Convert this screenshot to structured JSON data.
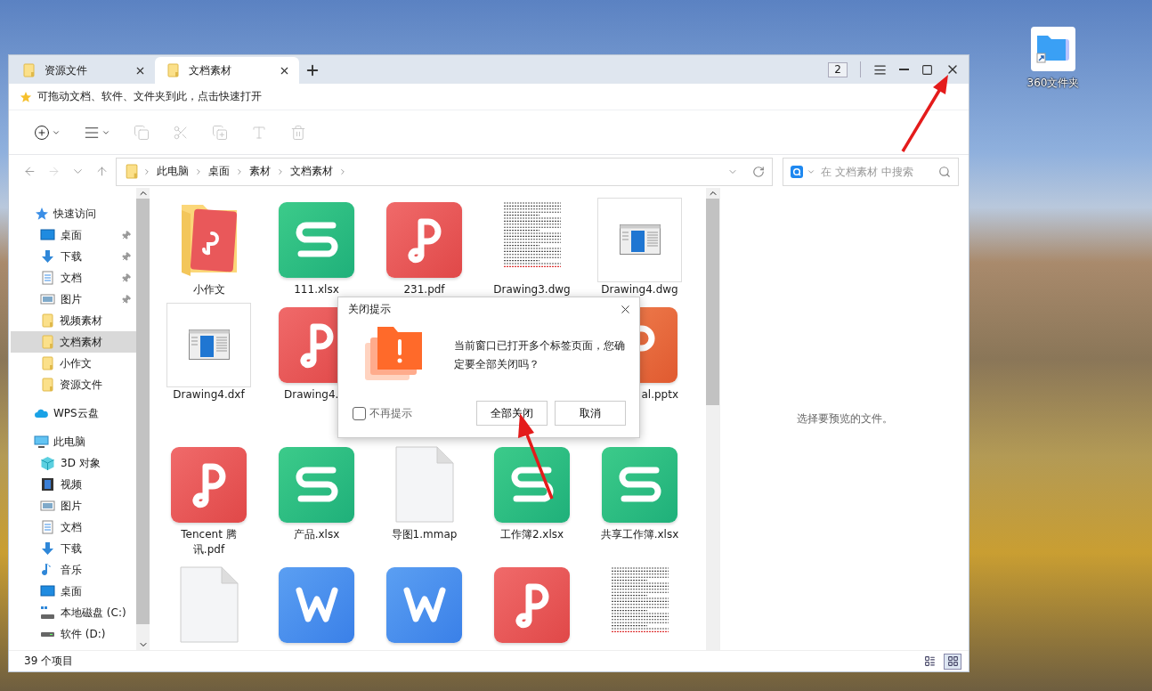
{
  "window": {
    "tabs": [
      {
        "label": "资源文件",
        "selected": false
      },
      {
        "label": "文档素材",
        "selected": true
      }
    ],
    "tab_count": "2",
    "quick_bar": {
      "hint": "可拖动文档、软件、文件夹到此，点击快速打开"
    },
    "toolbar": [
      {
        "kind": "new",
        "disabled": false,
        "dropdown": true
      },
      {
        "kind": "view",
        "disabled": false,
        "dropdown": true
      },
      {
        "kind": "copy",
        "disabled": true,
        "dropdown": false
      },
      {
        "kind": "cut",
        "disabled": true,
        "dropdown": false
      },
      {
        "kind": "paste",
        "disabled": true,
        "dropdown": false
      },
      {
        "kind": "rename",
        "disabled": true,
        "dropdown": false
      },
      {
        "kind": "delete",
        "disabled": true,
        "dropdown": false
      }
    ],
    "nav": [
      {
        "kind": "back",
        "disabled": false
      },
      {
        "kind": "forward",
        "disabled": true
      },
      {
        "kind": "recent",
        "disabled": false
      },
      {
        "kind": "up",
        "disabled": false
      }
    ],
    "address": {
      "breadcrumbs": [
        "此电脑",
        "桌面",
        "素材",
        "文档素材"
      ]
    },
    "search": {
      "placeholder": "在 文档素材 中搜索"
    },
    "sidebar": {
      "groups": [
        {
          "label": "快速访问",
          "kind": "star",
          "children": [
            {
              "label": "桌面",
              "kind": "desktop",
              "pinned": true,
              "selected": false
            },
            {
              "label": "下载",
              "kind": "download",
              "pinned": true,
              "selected": false
            },
            {
              "label": "文档",
              "kind": "document",
              "pinned": true,
              "selected": false
            },
            {
              "label": "图片",
              "kind": "picture",
              "pinned": true,
              "selected": false
            },
            {
              "label": "视频素材",
              "kind": "folder",
              "pinned": false,
              "selected": false
            },
            {
              "label": "文档素材",
              "kind": "folder",
              "pinned": false,
              "selected": true
            },
            {
              "label": "小作文",
              "kind": "folder",
              "pinned": false,
              "selected": false
            },
            {
              "label": "资源文件",
              "kind": "folder",
              "pinned": false,
              "selected": false
            }
          ]
        },
        {
          "label": "WPS云盘",
          "kind": "cloud"
        },
        {
          "label": "此电脑",
          "kind": "pc",
          "children": [
            {
              "label": "3D 对象",
              "kind": "cube",
              "pinned": false,
              "selected": false
            },
            {
              "label": "视频",
              "kind": "video",
              "pinned": false,
              "selected": false
            },
            {
              "label": "图片",
              "kind": "picture",
              "pinned": false,
              "selected": false
            },
            {
              "label": "文档",
              "kind": "document",
              "pinned": false,
              "selected": false
            },
            {
              "label": "下载",
              "kind": "download",
              "pinned": false,
              "selected": false
            },
            {
              "label": "音乐",
              "kind": "music",
              "pinned": false,
              "selected": false
            },
            {
              "label": "桌面",
              "kind": "desktop",
              "pinned": false,
              "selected": false
            },
            {
              "label": "本地磁盘 (C:)",
              "kind": "system-drive",
              "pinned": false,
              "selected": false
            },
            {
              "label": "软件 (D:)",
              "kind": "drive",
              "pinned": false,
              "selected": false
            }
          ]
        }
      ]
    },
    "files": {
      "rows": [
        [
          {
            "name": "小作文",
            "kind": "folder"
          },
          {
            "name": "111.xlsx",
            "kind": "sheet"
          },
          {
            "name": "231.pdf",
            "kind": "pdf"
          },
          {
            "name": "Drawing3.dwg",
            "kind": "text-page"
          },
          {
            "name": "Drawing4.dwg",
            "kind": "cad"
          }
        ],
        [
          {
            "name": "Drawing4.dxf",
            "kind": "cad"
          },
          {
            "name": "Drawing4.",
            "kind": "pdf"
          },
          {
            "kind": "covered"
          },
          {
            "kind": "covered"
          },
          {
            "name": "al.pptx",
            "kind": "slides"
          }
        ],
        [
          {
            "name": "Tencent 腾讯.pdf",
            "kind": "pdf"
          },
          {
            "name": "产品.xlsx",
            "kind": "sheet"
          },
          {
            "name": "导图1.mmap",
            "kind": "blank"
          },
          {
            "name": "工作簿2.xlsx",
            "kind": "sheet"
          },
          {
            "name": "共享工作簿.xlsx",
            "kind": "sheet"
          }
        ],
        [
          {
            "kind": "blank"
          },
          {
            "kind": "word"
          },
          {
            "kind": "word"
          },
          {
            "kind": "pdf"
          },
          {
            "kind": "text-page"
          }
        ]
      ]
    },
    "preview": {
      "message": "选择要预览的文件。"
    },
    "status_bar": {
      "count": "39 个项目",
      "views": [
        {
          "kind": "details",
          "selected": false
        },
        {
          "kind": "icons",
          "selected": true
        }
      ]
    }
  },
  "dialog": {
    "title": "关闭提示",
    "message": "当前窗口已打开多个标签页面，您确定要全部关闭吗？",
    "dont_ask": {
      "label": "不再提示",
      "checked": false
    },
    "buttons": [
      "全部关闭",
      "取消"
    ]
  },
  "desktop_icons": [
    {
      "label": "360文件夹"
    }
  ]
}
